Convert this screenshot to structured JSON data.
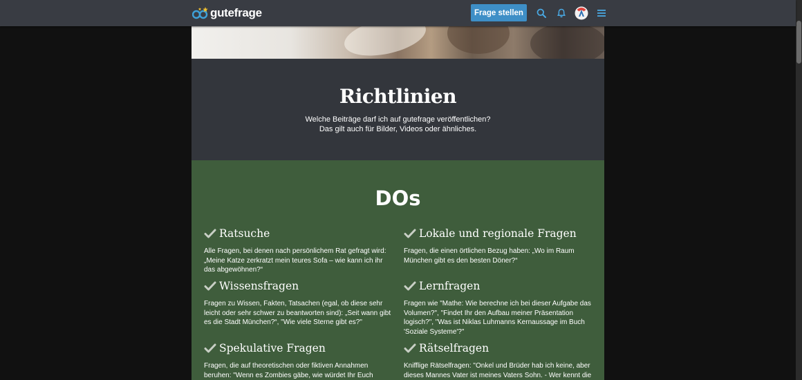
{
  "header": {
    "logo_text": "gutefrage",
    "ask_button_label": "Frage stellen",
    "icons": [
      "logo-icon",
      "search-icon",
      "bell-icon",
      "avatar",
      "menu-icon"
    ]
  },
  "hero": {
    "title": "Richtlinien",
    "subtitle_line1": "Welche Beiträge darf ich auf gutefrage veröffentlichen?",
    "subtitle_line2": "Das gilt auch für Bilder, Videos oder ähnliches."
  },
  "dos": {
    "heading": "DOs",
    "items": [
      {
        "title": "Ratsuche",
        "desc": "Alle Fragen, bei denen nach persönlichem Rat gefragt wird: „Meine Katze zerkratzt mein teures Sofa – wie kann ich ihr das abgewöhnen?“"
      },
      {
        "title": "Lokale und regionale Fragen",
        "desc": "Fragen, die einen örtlichen Bezug haben: „Wo im Raum München gibt es den besten Döner?“"
      },
      {
        "title": "Wissensfragen",
        "desc": "Fragen zu Wissen, Fakten, Tatsachen (egal, ob diese sehr leicht oder sehr schwer zu beantworten sind): „Seit wann gibt es die Stadt München?“, \"Wie viele Sterne gibt es?\""
      },
      {
        "title": "Lernfragen",
        "desc": "Fragen wie \"Mathe: Wie berechne ich bei dieser Aufgabe das Volumen?\", \"Findet Ihr den Aufbau meiner Präsentation logisch?\", \"Was ist Niklas Luhmanns Kernaussage im Buch 'Soziale Systeme'?\""
      },
      {
        "title": "Spekulative Fragen",
        "desc": "Fragen, die auf theoretischen oder fiktiven Annahmen beruhen: \"Wenn es Zombies gäbe, wie würdet Ihr Euch retten?\", \"Was"
      },
      {
        "title": "Rätselfragen",
        "desc": "Knifflige Rätselfragen: \"Onkel und Brüder hab ich keine, aber dieses Mannes Vater ist meines Vaters Sohn. - Wer kennt die"
      }
    ]
  },
  "colors": {
    "topbar": "#393c43",
    "accent": "#3e8fc7",
    "dark_section": "#33363c",
    "green_section": "#3f5d3c",
    "page_bg": "#111111"
  }
}
